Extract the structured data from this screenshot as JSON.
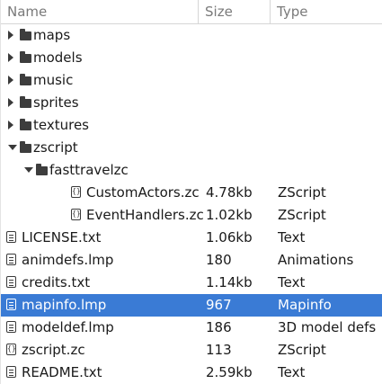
{
  "columns": {
    "name": "Name",
    "size": "Size",
    "type": "Type"
  },
  "rows": [
    {
      "name": "maps",
      "size": "",
      "type": "",
      "kind": "folder",
      "depth": 0,
      "expander": "collapsed"
    },
    {
      "name": "models",
      "size": "",
      "type": "",
      "kind": "folder",
      "depth": 0,
      "expander": "collapsed"
    },
    {
      "name": "music",
      "size": "",
      "type": "",
      "kind": "folder",
      "depth": 0,
      "expander": "collapsed"
    },
    {
      "name": "sprites",
      "size": "",
      "type": "",
      "kind": "folder",
      "depth": 0,
      "expander": "collapsed"
    },
    {
      "name": "textures",
      "size": "",
      "type": "",
      "kind": "folder",
      "depth": 0,
      "expander": "collapsed"
    },
    {
      "name": "zscript",
      "size": "",
      "type": "",
      "kind": "folder",
      "depth": 0,
      "expander": "expanded"
    },
    {
      "name": "fasttravelzc",
      "size": "",
      "type": "",
      "kind": "folder",
      "depth": 1,
      "expander": "expanded"
    },
    {
      "name": "CustomActors.zc",
      "size": "4.78kb",
      "type": "ZScript",
      "kind": "code",
      "depth": 2,
      "expander": "none"
    },
    {
      "name": "EventHandlers.zc",
      "size": "1.02kb",
      "type": "ZScript",
      "kind": "code",
      "depth": 2,
      "expander": "none"
    },
    {
      "name": "LICENSE.txt",
      "size": "1.06kb",
      "type": "Text",
      "kind": "text",
      "depth": 0,
      "expander": "none"
    },
    {
      "name": "animdefs.lmp",
      "size": "180",
      "type": "Animations",
      "kind": "text",
      "depth": 0,
      "expander": "none"
    },
    {
      "name": "credits.txt",
      "size": "1.14kb",
      "type": "Text",
      "kind": "text",
      "depth": 0,
      "expander": "none"
    },
    {
      "name": "mapinfo.lmp",
      "size": "967",
      "type": "Mapinfo",
      "kind": "text",
      "depth": 0,
      "expander": "none",
      "selected": true
    },
    {
      "name": "modeldef.lmp",
      "size": "186",
      "type": "3D model defs",
      "kind": "text",
      "depth": 0,
      "expander": "none"
    },
    {
      "name": "zscript.zc",
      "size": "113",
      "type": "ZScript",
      "kind": "code",
      "depth": 0,
      "expander": "none"
    },
    {
      "name": "README.txt",
      "size": "2.59kb",
      "type": "Text",
      "kind": "text",
      "depth": 0,
      "expander": "none"
    }
  ],
  "colors": {
    "selection": "#3a7bd5",
    "icon": "#3a3a3a"
  }
}
